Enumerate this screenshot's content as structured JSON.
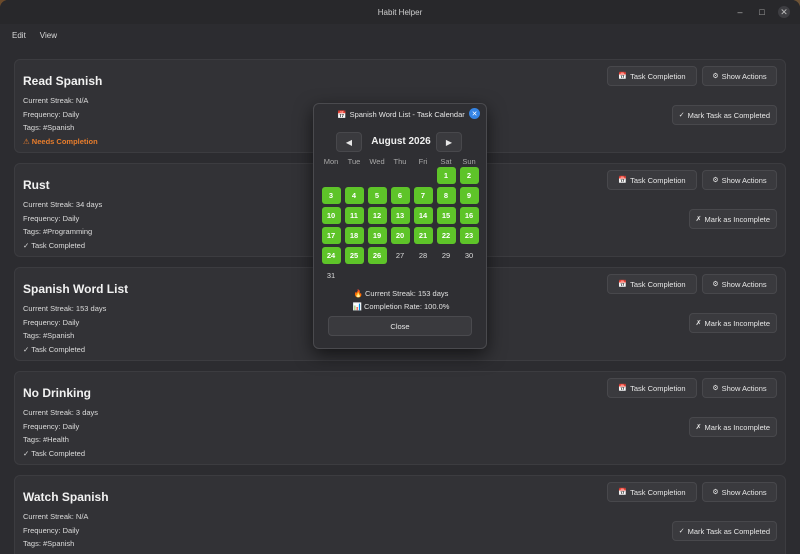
{
  "window": {
    "title": "Habit Helper"
  },
  "menu": [
    "Edit",
    "View"
  ],
  "labels": {
    "task_completion": "Task Completion",
    "show_actions": "Show Actions",
    "mark_complete": "Mark Task as Completed",
    "mark_incomplete": "Mark as Incomplete"
  },
  "habits": [
    {
      "name": "Read Spanish",
      "streak": "Current Streak: N/A",
      "frequency": "Frequency: Daily",
      "tags": "Tags:  #Spanish",
      "status": "⚠ Needs Completion",
      "status_type": "warn",
      "action": "Mark Task as Completed",
      "action_icon": "✓"
    },
    {
      "name": "Rust",
      "streak": "Current Streak: 34 days",
      "frequency": "Frequency: Daily",
      "tags": "Tags:  #Programming",
      "status": "✓ Task Completed",
      "status_type": "ok",
      "action": "Mark as Incomplete",
      "action_icon": "✗"
    },
    {
      "name": "Spanish Word List",
      "streak": "Current Streak: 153 days",
      "frequency": "Frequency: Daily",
      "tags": "Tags:  #Spanish",
      "status": "✓ Task Completed",
      "status_type": "ok",
      "action": "Mark as Incomplete",
      "action_icon": "✗"
    },
    {
      "name": "No Drinking",
      "streak": "Current Streak: 3 days",
      "frequency": "Frequency: Daily",
      "tags": "Tags:  #Health",
      "status": "✓ Task Completed",
      "status_type": "ok",
      "action": "Mark as Incomplete",
      "action_icon": "✗"
    },
    {
      "name": "Watch Spanish",
      "streak": "Current Streak: N/A",
      "frequency": "Frequency: Daily",
      "tags": "Tags:  #Spanish",
      "status": "⚠ Needs Completion",
      "status_type": "warn",
      "action": "Mark Task as Completed",
      "action_icon": "✓"
    }
  ],
  "dialog": {
    "title": "Spanish Word List - Task Calendar",
    "month": "August 2026",
    "weekdays": [
      "Mon",
      "Tue",
      "Wed",
      "Thu",
      "Fri",
      "Sat",
      "Sun"
    ],
    "first_weekday_index": 5,
    "days_in_month": 31,
    "completed_days": [
      1,
      2,
      3,
      4,
      5,
      6,
      7,
      8,
      9,
      10,
      11,
      12,
      13,
      14,
      15,
      16,
      17,
      18,
      19,
      20,
      21,
      22,
      23,
      24,
      25,
      26
    ],
    "streak": "🔥 Current Streak: 153 days",
    "completion_rate": "📊 Completion Rate: 100.0%",
    "close_label": "Close",
    "accent_color": "#5ec429"
  }
}
